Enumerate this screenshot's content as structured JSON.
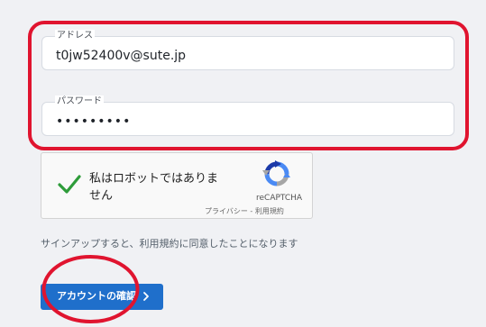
{
  "form": {
    "address_label": "アドレス",
    "address_value": "t0jw52400v@sute.jp",
    "password_label": "パスワード",
    "password_value": "•••••••••"
  },
  "captcha": {
    "label": "私はロボットではありません",
    "brand": "reCAPTCHA",
    "privacy": "プライバシー",
    "separator": "-",
    "terms": "利用規約"
  },
  "agreement_text": "サインアップすると、利用規約に同意したことになります",
  "confirm_button": {
    "label": "アカウントの確認"
  },
  "colors": {
    "highlight": "#e0142f",
    "accent": "#1f6fcb",
    "check": "#2e9c3a"
  }
}
